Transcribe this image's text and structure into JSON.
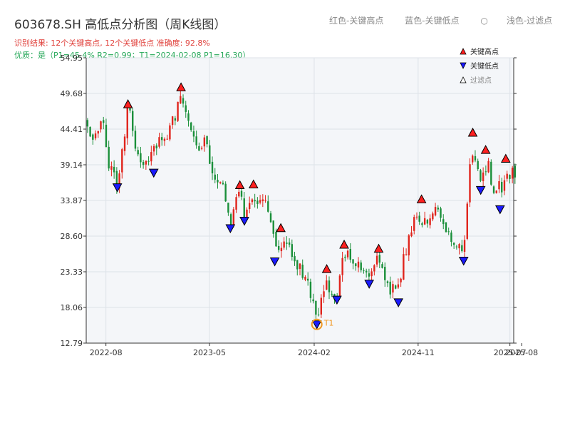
{
  "header": {
    "title": "603678.SH 高低点分析图（周K线图）",
    "legend_high": "红色-关键高点",
    "legend_low": "蓝色-关键低点",
    "legend_filtered": "浅色-过滤点",
    "result_line": "识别结果: 12个关键高点, 12个关键低点  准确度: 92.8%",
    "quality_line": "优质：是（P1=45.4%  R2=0.99；T1=2024-02-08 P1=16.30）"
  },
  "colors": {
    "up": "#e0241c",
    "down": "#1a8f3a",
    "high_marker": "#ff2020",
    "low_marker": "#1a1aff",
    "t1_marker": "#f0961e",
    "plot_bg": "#f4f6f9",
    "grid": "#dde2e8"
  },
  "chart_data": {
    "type": "candlestick",
    "ylim": [
      12.79,
      54.95
    ],
    "yticks": [
      "54.95",
      "49.68",
      "44.41",
      "39.14",
      "33.87",
      "28.60",
      "23.33",
      "18.06",
      "12.79"
    ],
    "x_start": "2022-06-10",
    "x_end": "2025-07-11",
    "xticks": [
      {
        "date": "2022-08-01",
        "label": "2022-08"
      },
      {
        "date": "2023-05-01",
        "label": "2023-05"
      },
      {
        "date": "2024-02-01",
        "label": "2024-02"
      },
      {
        "date": "2024-11-01",
        "label": "2024-11"
      },
      {
        "date": "2025-07-01",
        "label": "2025-07"
      },
      {
        "date": "2025-08-01",
        "label": "2025-08"
      }
    ],
    "price_path": [
      [
        "2022-06-10",
        45.5
      ],
      [
        "2022-06-30",
        42.0
      ],
      [
        "2022-07-20",
        47.0
      ],
      [
        "2022-08-10",
        38.5
      ],
      [
        "2022-08-31",
        36.5
      ],
      [
        "2022-09-28",
        47.5
      ],
      [
        "2022-10-25",
        40.5
      ],
      [
        "2022-11-10",
        38.5
      ],
      [
        "2022-12-10",
        42.0
      ],
      [
        "2023-01-10",
        43.5
      ],
      [
        "2023-02-15",
        49.0
      ],
      [
        "2023-03-10",
        44.0
      ],
      [
        "2023-04-05",
        40.5
      ],
      [
        "2023-04-20",
        42.5
      ],
      [
        "2023-05-15",
        37.0
      ],
      [
        "2023-06-10",
        35.5
      ],
      [
        "2023-06-25",
        30.0
      ],
      [
        "2023-07-15",
        35.0
      ],
      [
        "2023-08-05",
        31.5
      ],
      [
        "2023-08-25",
        35.0
      ],
      [
        "2023-09-25",
        33.0
      ],
      [
        "2023-10-25",
        26.0
      ],
      [
        "2023-11-10",
        28.5
      ],
      [
        "2023-12-05",
        26.0
      ],
      [
        "2024-01-10",
        22.0
      ],
      [
        "2024-02-08",
        16.5
      ],
      [
        "2024-03-05",
        22.0
      ],
      [
        "2024-04-01",
        19.5
      ],
      [
        "2024-04-20",
        26.5
      ],
      [
        "2024-05-20",
        25.0
      ],
      [
        "2024-06-20",
        22.5
      ],
      [
        "2024-07-20",
        26.0
      ],
      [
        "2024-08-20",
        20.0
      ],
      [
        "2024-09-10",
        21.5
      ],
      [
        "2024-09-25",
        25.5
      ],
      [
        "2024-10-25",
        31.5
      ],
      [
        "2024-11-25",
        30.0
      ],
      [
        "2024-12-15",
        34.0
      ],
      [
        "2025-01-15",
        29.0
      ],
      [
        "2025-02-10",
        26.5
      ],
      [
        "2025-03-05",
        27.5
      ],
      [
        "2025-03-20",
        42.0
      ],
      [
        "2025-04-15",
        37.5
      ],
      [
        "2025-05-05",
        39.5
      ],
      [
        "2025-05-20",
        35.0
      ],
      [
        "2025-06-10",
        36.0
      ],
      [
        "2025-06-25",
        37.5
      ],
      [
        "2025-07-11",
        38.0
      ]
    ],
    "key_highs": [
      [
        "2022-09-28",
        47.35
      ],
      [
        "2023-02-15",
        49.85
      ],
      [
        "2023-07-20",
        35.4
      ],
      [
        "2023-08-25",
        35.5
      ],
      [
        "2023-11-05",
        29.05
      ],
      [
        "2024-03-05",
        23.0
      ],
      [
        "2024-04-20",
        26.6
      ],
      [
        "2024-07-20",
        26.0
      ],
      [
        "2024-11-10",
        33.3
      ],
      [
        "2025-03-25",
        43.15
      ],
      [
        "2025-04-28",
        40.6
      ],
      [
        "2025-06-20",
        39.3
      ]
    ],
    "key_lows": [
      [
        "2022-08-31",
        36.55
      ],
      [
        "2022-12-05",
        38.7
      ],
      [
        "2023-06-25",
        30.5
      ],
      [
        "2023-08-01",
        31.6
      ],
      [
        "2023-10-20",
        25.6
      ],
      [
        "2024-02-08",
        16.3
      ],
      [
        "2024-04-01",
        19.95
      ],
      [
        "2024-06-25",
        22.3
      ],
      [
        "2024-09-10",
        19.55
      ],
      [
        "2025-03-01",
        25.7
      ],
      [
        "2025-04-15",
        36.15
      ],
      [
        "2025-06-05",
        33.3
      ]
    ],
    "t1": {
      "date": "2024-02-08",
      "price": 16.3,
      "label": "T1"
    },
    "legend": [
      {
        "kind": "high",
        "label": "关键高点"
      },
      {
        "kind": "low",
        "label": "关键低点"
      },
      {
        "kind": "filtered",
        "label": "过滤点"
      }
    ]
  }
}
